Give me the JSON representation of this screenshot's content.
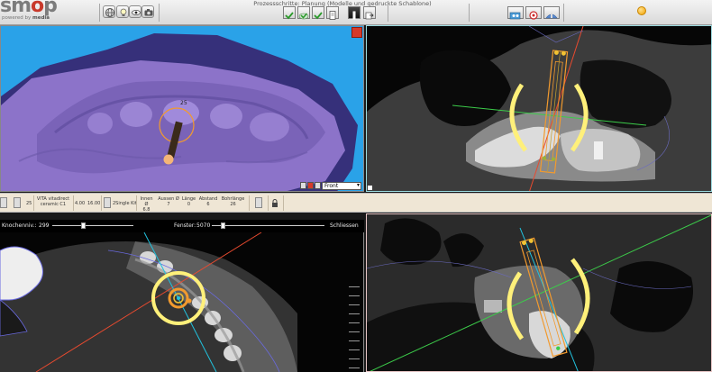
{
  "header": {
    "logo_word_start": "sm",
    "logo_word_o": "o",
    "logo_word_end": "p",
    "logo_powered": "powered by",
    "logo_brand": "media",
    "process_title": "Prozessschritte: Planung (Modelle und gedruckte Schablone)",
    "icons": [
      "globe-icon",
      "bulb-icon",
      "eye-icon",
      "camera-icon",
      "check-icon",
      "check-cloud-icon",
      "check-icon",
      "document-icon",
      "implant-icon",
      "export-icon"
    ]
  },
  "vp3d": {
    "label_number": "25",
    "view_option": "Front"
  },
  "infobar": {
    "num1": "25",
    "material_line1": "VITA vitadirect",
    "material_line2": "ceramic C1",
    "val_a": "4.00",
    "val_b": "16.00",
    "kit": "2Single Kit",
    "fields": [
      {
        "label": "Innen Ø",
        "value": "6.8"
      },
      {
        "label": "Aussen Ø",
        "value": "7"
      },
      {
        "label": "Länge",
        "value": "0"
      },
      {
        "label": "Abstand",
        "value": "6"
      },
      {
        "label": "Bohrlänge",
        "value": "26"
      }
    ]
  },
  "sliders": {
    "bone_label": "Knochenniv.:",
    "bone_value": "299",
    "bone_level": 0.38,
    "window_label": "Fenster:",
    "window_value": "5070",
    "window_level": 0.1,
    "close_label": "Schliessen"
  },
  "colors": {
    "header_bg": "#e6e6e6",
    "viewport_3d_bg": "#2aa2e8",
    "model_purple": "#8c73c9",
    "implant_orange": "#f29a2e",
    "arc_yellow": "#fff07a",
    "axis_red": "#e84a2f",
    "axis_green": "#3ccc4a",
    "axis_cyan": "#21c2de",
    "infobar_bg": "#efe6d5"
  }
}
